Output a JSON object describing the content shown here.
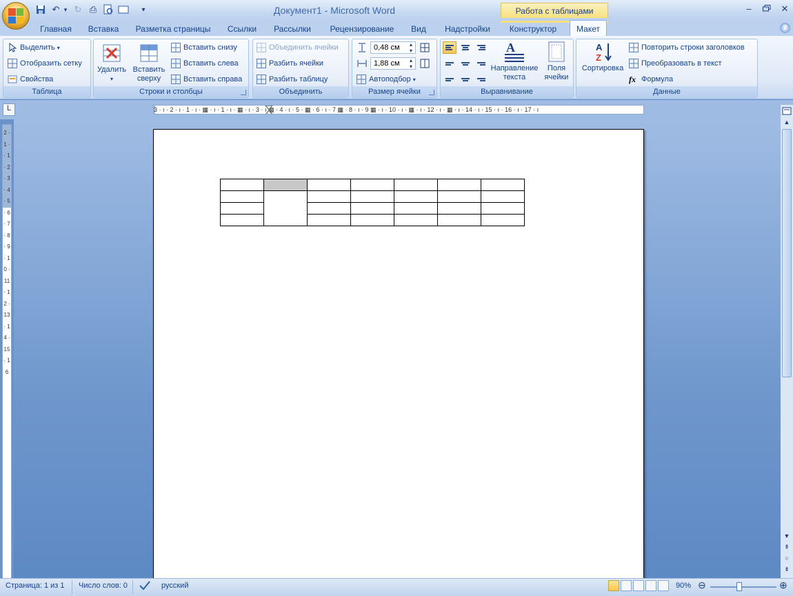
{
  "window": {
    "title": "Документ1 - Microsoft Word",
    "context_tab_group": "Работа с таблицами",
    "controls": {
      "minimize": "–",
      "restore": "▫",
      "close": "✕"
    }
  },
  "quick_access": [
    {
      "name": "save-icon",
      "glyph": "💾"
    },
    {
      "name": "undo-icon",
      "glyph": "↶"
    },
    {
      "name": "redo-icon",
      "glyph": "↻"
    },
    {
      "name": "print-icon",
      "glyph": "⎙"
    },
    {
      "name": "print-preview-icon",
      "glyph": "🔍"
    },
    {
      "name": "open-icon",
      "glyph": "▭"
    },
    {
      "name": "customize-icon",
      "glyph": "▾"
    }
  ],
  "tabs": [
    "Главная",
    "Вставка",
    "Разметка страницы",
    "Ссылки",
    "Рассылки",
    "Рецензирование",
    "Вид",
    "Надстройки",
    "Конструктор",
    "Макет"
  ],
  "active_tab": "Макет",
  "help_glyph": "?",
  "ribbon": {
    "table": {
      "label": "Таблица",
      "select": "Выделить",
      "show_grid": "Отобразить сетку",
      "properties": "Свойства"
    },
    "rows_cols": {
      "label": "Строки и столбцы",
      "delete": "Удалить",
      "insert_above_1": "Вставить",
      "insert_above_2": "сверху",
      "insert_below": "Вставить снизу",
      "insert_left": "Вставить слева",
      "insert_right": "Вставить справа"
    },
    "merge": {
      "label": "Объединить",
      "merge_cells": "Объединить ячейки",
      "split_cells": "Разбить ячейки",
      "split_table": "Разбить таблицу"
    },
    "cell_size": {
      "label": "Размер ячейки",
      "height": "0,48 см",
      "width": "1,88 см",
      "autofit": "Автоподбор"
    },
    "alignment": {
      "label": "Выравнивание",
      "text_direction_1": "Направление",
      "text_direction_2": "текста",
      "cell_margins_1": "Поля",
      "cell_margins_2": "ячейки"
    },
    "data": {
      "label": "Данные",
      "sort": "Сортировка",
      "repeat_headers": "Повторить строки заголовков",
      "convert_to_text": "Преобразовать в текст",
      "formula": "Формула",
      "formula_glyph": "fx"
    }
  },
  "ruler": {
    "horizontal": "3 · ı · 2 · ı · 1 · ı · ▦ · ı · 1 · ı · ▦ · ı · 3 · ı ▦ · 4 · ı · 5 · ▦ · 6 · ı · 7 ▦ · 8 · ı · 9 ▦ · ı · 10 · ı · ▦ · ı · 12 · ı · ▦ · ı · 14 · ı · 15 · ı · 16 · ı · 17 · ı",
    "vertical": "2 · 1 · · 1 · 2 · 3 · 4 · 5 · 6 · 7 · 8 · 9 · 10 · 11 · 12 · 13 · 14 · 15 · 16",
    "tab_selector": "L"
  },
  "document_table": {
    "rows": 4,
    "cols": 7,
    "selected_cell": [
      0,
      1
    ],
    "merged_below_selected": true
  },
  "status": {
    "page": "Страница: 1 из 1",
    "words": "Число слов: 0",
    "language": "русский",
    "zoom": "90%",
    "zoom_minus": "⊖",
    "zoom_plus": "⊕"
  }
}
